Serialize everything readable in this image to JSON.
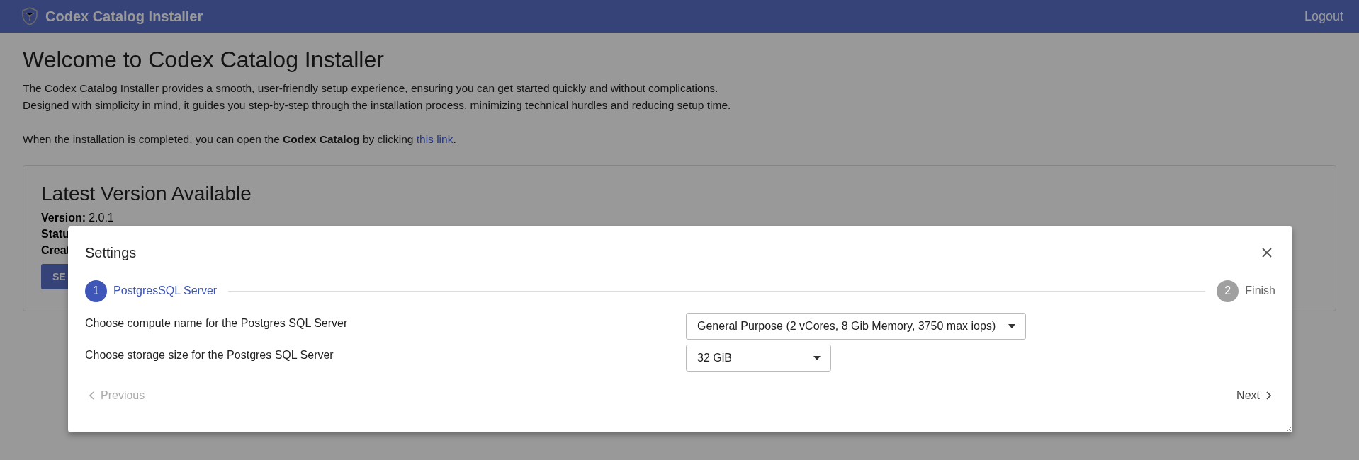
{
  "header": {
    "title": "Codex Catalog Installer",
    "logout": "Logout"
  },
  "intro": {
    "title": "Welcome to Codex Catalog Installer",
    "paragraphs": [
      "The Codex Catalog Installer provides a smooth, user-friendly setup experience, ensuring you can get started quickly and without complications.",
      "Designed with simplicity in mind, it guides you step-by-step through the installation process, minimizing technical hurdles and reducing setup time."
    ],
    "open_text_before": "When the installation is completed, you can open the **Codex Catalog** by clicking",
    "link": "this link",
    "open_text_after": "."
  },
  "card": {
    "title": "Latest Version Available",
    "fields": [
      {
        "label": "Version:",
        "value": "2.0.1"
      },
      {
        "label": "Statu"
      },
      {
        "label": "Creat"
      }
    ],
    "button": "SE"
  },
  "modal": {
    "title": "Settings",
    "steps": [
      {
        "number": "1",
        "label": "PostgresSQL Server",
        "selected": true
      },
      {
        "number": "2",
        "label": "Finish",
        "selected": false
      }
    ],
    "settings": [
      {
        "label": "Choose compute name for the Postgres SQL Server",
        "value": "General Purpose (2 vCores, 8 Gib Memory, 3750 max iops)"
      },
      {
        "label": "Choose storage size for the Postgres SQL Server",
        "value": "32 GiB"
      }
    ],
    "previous": {
      "label": "Previous",
      "disabled": true
    },
    "next": {
      "label": "Next",
      "disabled": false
    }
  }
}
